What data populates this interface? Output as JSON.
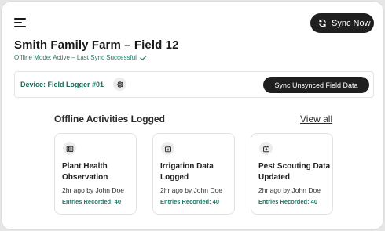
{
  "header": {
    "menu_icon": "hamburger-menu-icon",
    "sync_now_label": "Sync Now",
    "sync_icon": "sync-refresh-icon"
  },
  "farm": {
    "title": "Smith Family Farm – Field 12",
    "status": "Offline Mode: Active – Last Sync Successful",
    "status_icon": "check-icon"
  },
  "device": {
    "label": "Device: Field Logger #01",
    "settings_icon": "gear-icon",
    "sync_button_label": "Sync Unsynced Field Data"
  },
  "activities": {
    "title": "Offline Activities Logged",
    "view_all_label": "View all",
    "cards": [
      {
        "icon": "plant-health-icon",
        "title": "Plant Health Observation",
        "meta": "2hr ago by John Doe",
        "entries": "Entries Recorded: 40"
      },
      {
        "icon": "irrigation-icon",
        "title": "Irrigation Data Logged",
        "meta": "2hr ago by John Doe",
        "entries": "Entries Recorded: 40"
      },
      {
        "icon": "pest-scouting-icon",
        "title": "Pest Scouting Data Updated",
        "meta": "2hr ago by John Doe",
        "entries": "Entries Recorded: 40"
      }
    ]
  },
  "colors": {
    "accent_green": "#1b7a67",
    "button_dark": "#1f1f1f",
    "background": "#ffffff"
  }
}
